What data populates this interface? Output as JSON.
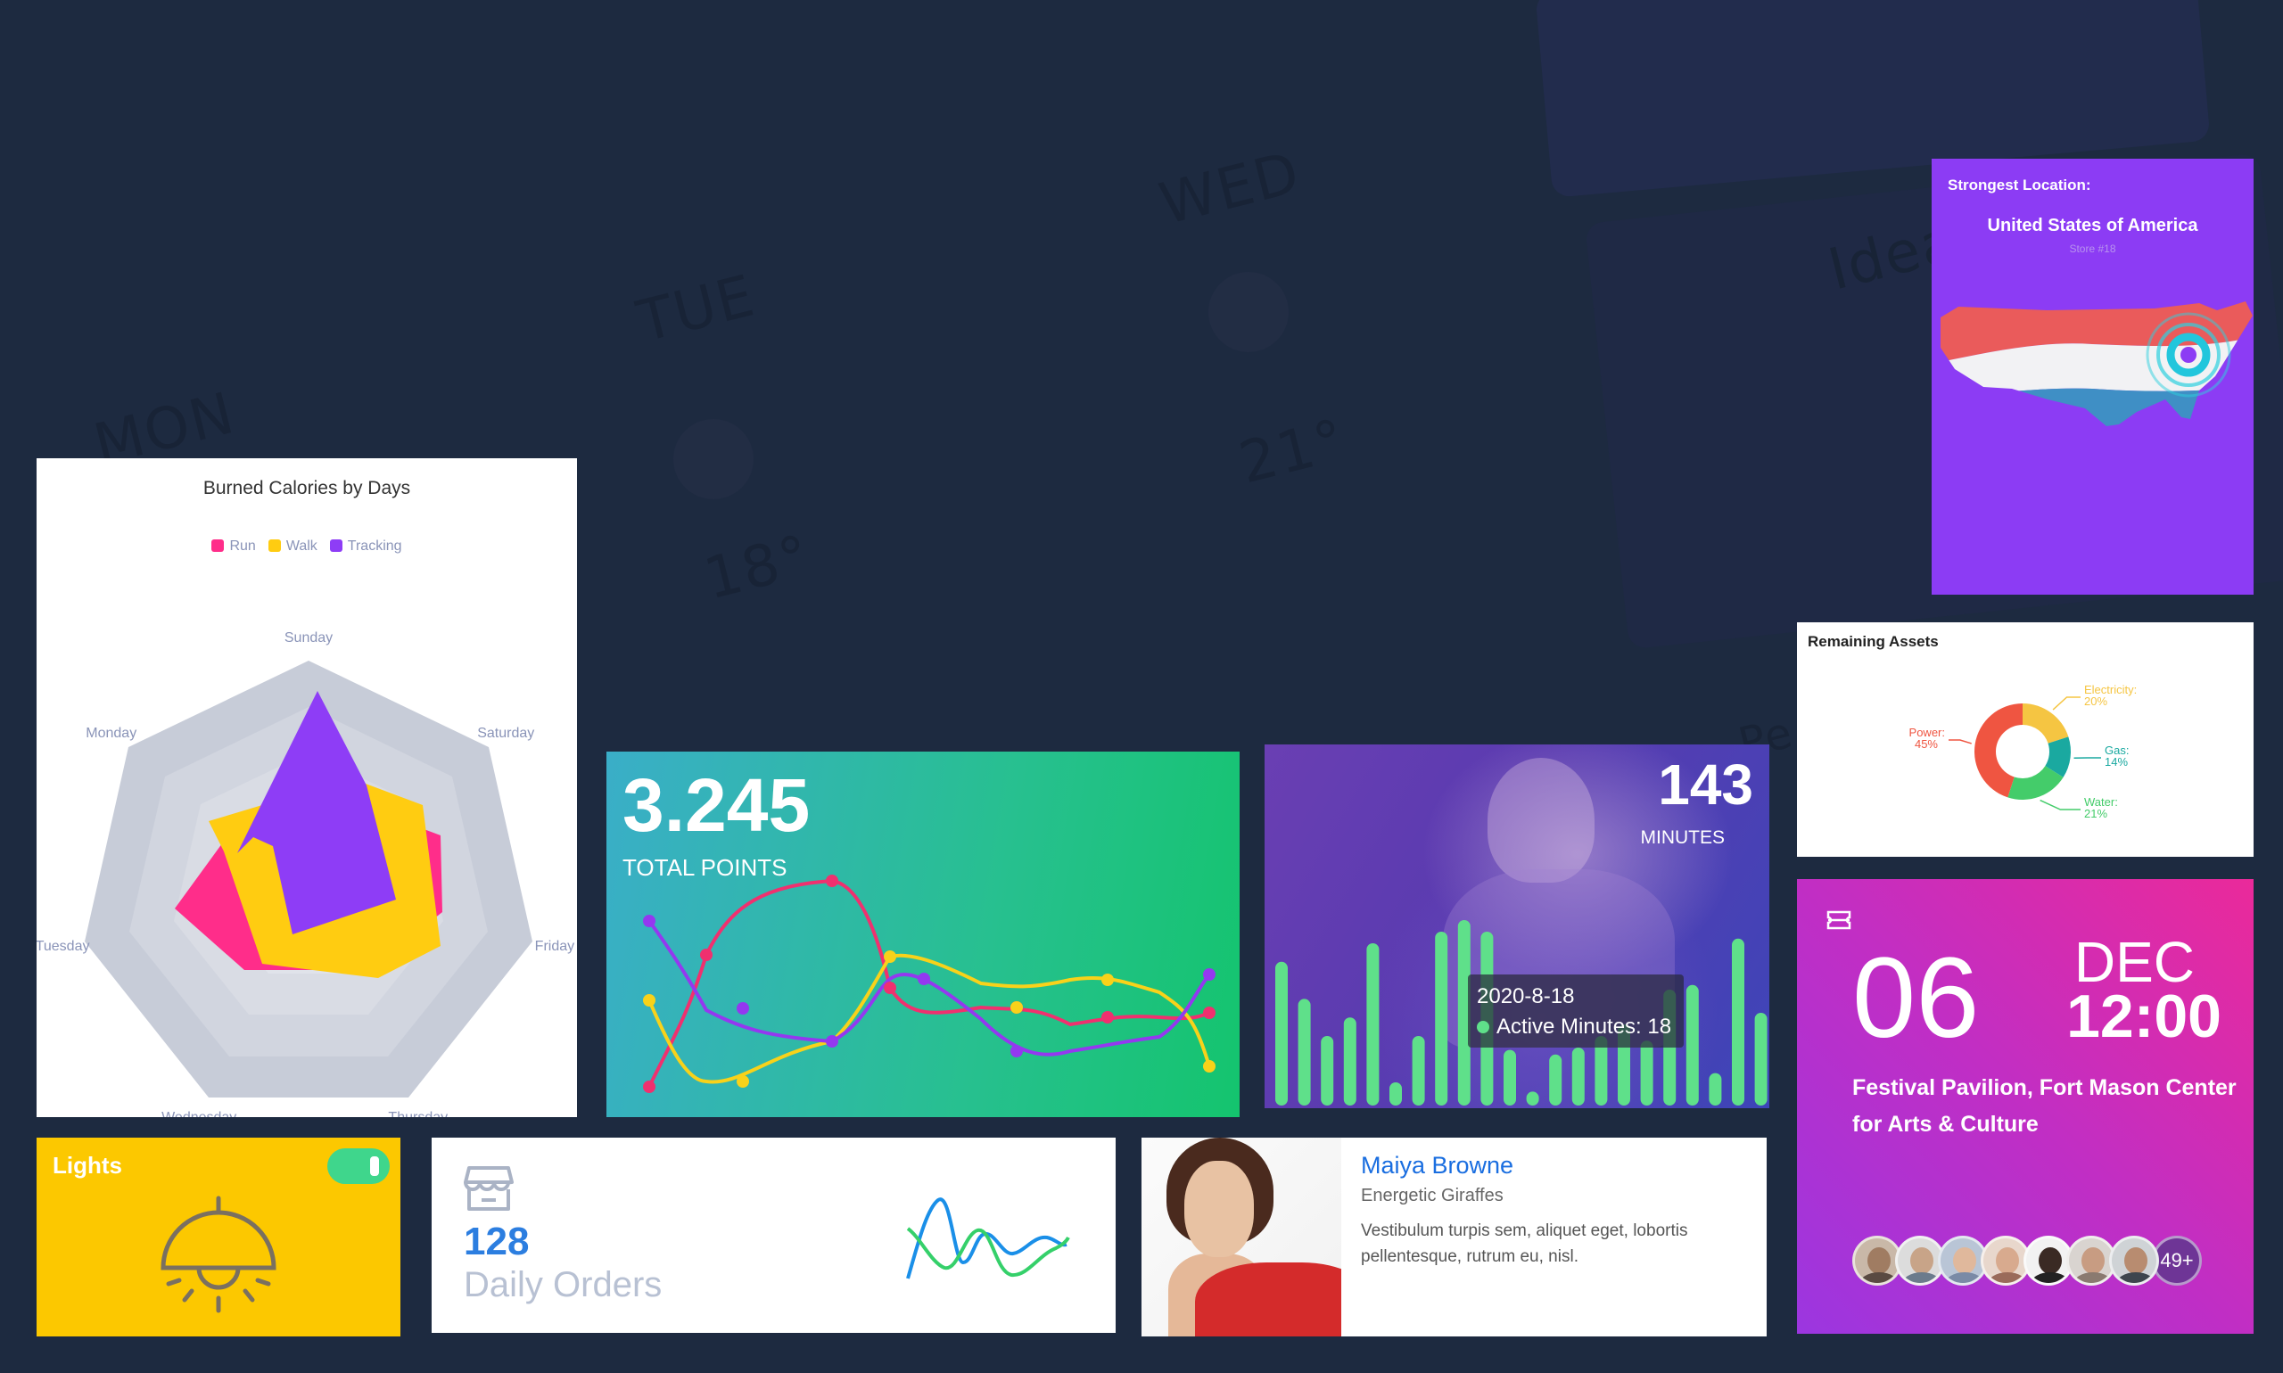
{
  "background": {
    "days": [
      "MON",
      "TUE",
      "WED"
    ],
    "temps": [
      "18°",
      "21°"
    ],
    "panel_text": [
      "Idea",
      "Pe"
    ]
  },
  "radar": {
    "title": "Burned Calories by Days",
    "legend": [
      {
        "name": "Run",
        "color": "#ff2d8a"
      },
      {
        "name": "Walk",
        "color": "#ffcc11"
      },
      {
        "name": "Tracking",
        "color": "#8e3df6"
      }
    ],
    "axes": [
      "Sunday",
      "Saturday",
      "Friday",
      "Thursday",
      "Wednesday",
      "Tuesday",
      "Monday"
    ]
  },
  "points": {
    "value": "3.245",
    "label": "TOTAL POINTS"
  },
  "minutes": {
    "value": "143",
    "label": "MINUTES",
    "tooltip_date": "2020-8-18",
    "tooltip_text": "Active Minutes: 18",
    "bar_values": [
      0.62,
      0.46,
      0.3,
      0.38,
      0.7,
      0.1,
      0.3,
      0.75,
      0.8,
      0.75,
      0.24,
      0.06,
      0.22,
      0.25,
      0.3,
      0.35,
      0.28,
      0.5,
      0.52,
      0.14,
      0.72,
      0.4
    ]
  },
  "location": {
    "heading": "Strongest Location:",
    "country": "United States of America",
    "store": "Store #18"
  },
  "assets": {
    "title": "Remaining Assets",
    "segments": [
      {
        "label": "Electricity:",
        "percent": "20%",
        "value": 20,
        "color": "#f5c542"
      },
      {
        "label": "Gas:",
        "percent": "14%",
        "value": 14,
        "color": "#1aa9a0"
      },
      {
        "label": "Water:",
        "percent": "21%",
        "value": 21,
        "color": "#44cc6a"
      },
      {
        "label": "Power:",
        "percent": "45%",
        "value": 45,
        "color": "#ef5541"
      }
    ]
  },
  "event": {
    "day": "06",
    "month": "DEC",
    "time": "12:00",
    "venue": "Festival Pavilion, Fort Mason Center for Arts & Culture",
    "more_count": "49+"
  },
  "lights": {
    "label": "Lights",
    "on": true
  },
  "orders": {
    "count": "128",
    "label": "Daily Orders"
  },
  "profile": {
    "name": "Maiya Browne",
    "team": "Energetic Giraffes",
    "description": "Vestibulum turpis sem, aliquet eget, lobortis pellentesque, rutrum eu, nisl."
  }
}
